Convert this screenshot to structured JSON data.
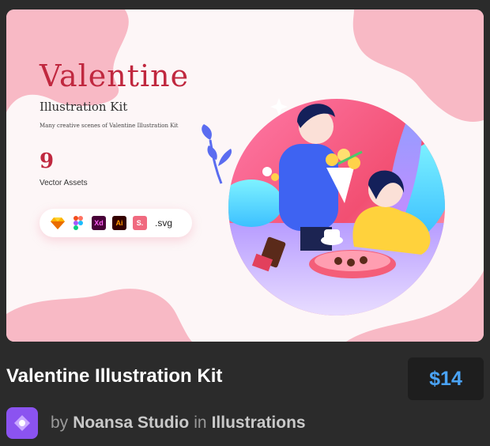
{
  "preview": {
    "heading": "Valentine",
    "subheading": "Illustration Kit",
    "tagline": "Many creative scenes of Valentine Illustration Kit",
    "asset_count": "9",
    "asset_label": "Vector Assets",
    "formats": [
      {
        "icon": "sketch-icon"
      },
      {
        "icon": "figma-icon"
      },
      {
        "icon": "xd-icon",
        "text": "Xd"
      },
      {
        "icon": "illustrator-icon",
        "text": "Ai"
      },
      {
        "icon": "s-icon",
        "text": "S."
      },
      {
        "icon": "svg-label",
        "text": ".svg"
      }
    ],
    "colors": {
      "accent": "#c0283f",
      "blob": "#f8b7c3",
      "circle": "#f25b8a"
    }
  },
  "product": {
    "title": "Valentine Illustration Kit",
    "price": "$14"
  },
  "author": {
    "by": "by",
    "name": "Noansa Studio",
    "in": "in",
    "category": "Illustrations"
  },
  "colors": {
    "page_bg": "#2b2b2b",
    "price": "#4aa3f5",
    "avatar": "#8b53f0"
  }
}
